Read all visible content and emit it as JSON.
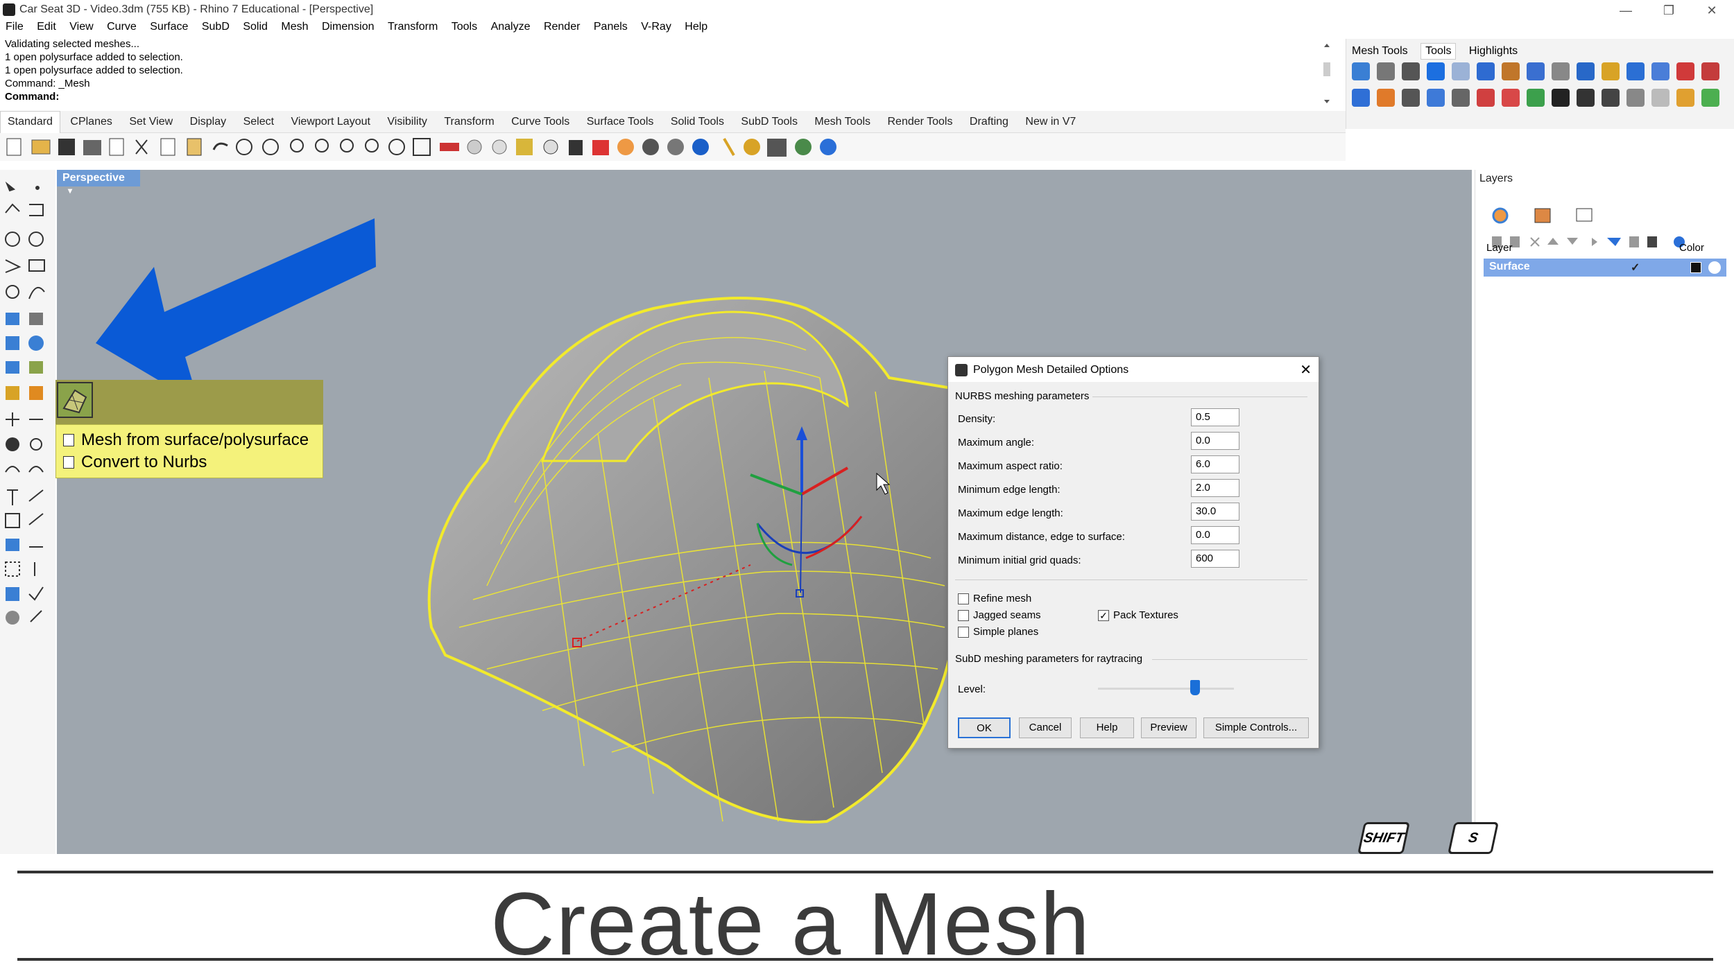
{
  "window": {
    "title": "Car Seat 3D - Video.3dm (755 KB) - Rhino 7 Educational - [Perspective]",
    "minimize": "—",
    "restore": "❐",
    "close": "✕"
  },
  "menu": [
    "File",
    "Edit",
    "View",
    "Curve",
    "Surface",
    "SubD",
    "Solid",
    "Mesh",
    "Dimension",
    "Transform",
    "Tools",
    "Analyze",
    "Render",
    "Panels",
    "V-Ray",
    "Help"
  ],
  "command_history": [
    "Validating selected meshes...",
    "1 open polysurface added to selection.",
    "1 open polysurface added to selection.",
    "Command: _Mesh"
  ],
  "command_prompt": "Command:",
  "toolbar_tabs": [
    "Standard",
    "CPlanes",
    "Set View",
    "Display",
    "Select",
    "Viewport Layout",
    "Visibility",
    "Transform",
    "Curve Tools",
    "Surface Tools",
    "Solid Tools",
    "SubD Tools",
    "Mesh Tools",
    "Render Tools",
    "Drafting",
    "New in V7"
  ],
  "right_panel_tabs": [
    "Mesh Tools",
    "Tools",
    "Highlights"
  ],
  "viewport": {
    "label": "Perspective"
  },
  "layers_panel": {
    "title": "Layers",
    "col_layer": "Layer",
    "col_color": "Color",
    "row_name": "Surface",
    "row_check": "✓"
  },
  "tooltip": {
    "items": [
      "Mesh from surface/polysurface",
      "Convert to Nurbs"
    ]
  },
  "dialog": {
    "title": "Polygon Mesh Detailed Options",
    "close": "✕",
    "nurbs_section": "NURBS meshing parameters",
    "params": [
      {
        "label": "Density:",
        "value": "0.5"
      },
      {
        "label": "Maximum angle:",
        "value": "0.0"
      },
      {
        "label": "Maximum aspect ratio:",
        "value": "6.0"
      },
      {
        "label": "Minimum edge length:",
        "value": "2.0"
      },
      {
        "label": "Maximum edge length:",
        "value": "30.0"
      },
      {
        "label": "Maximum distance, edge to surface:",
        "value": "0.0"
      },
      {
        "label": "Minimum initial grid quads:",
        "value": "600"
      }
    ],
    "checkboxes": {
      "refine_mesh": "Refine mesh",
      "jagged_seams": "Jagged seams",
      "simple_planes": "Simple planes",
      "pack_textures": "Pack Textures",
      "pack_mark": "✓"
    },
    "subd_section": "SubD meshing parameters for raytracing",
    "level_label": "Level:",
    "level_value_fraction": 0.73,
    "buttons": {
      "ok": "OK",
      "cancel": "Cancel",
      "help": "Help",
      "preview": "Preview",
      "simple": "Simple Controls..."
    }
  },
  "keys": {
    "shift": "SHIFT",
    "s": "S"
  },
  "caption": "Create a Mesh",
  "colors": {
    "viewport_bg": "#9ea6ae",
    "wire": "#f2ea2c",
    "arrow": "#0a5ad6",
    "tooltip_bg": "#f4f27b",
    "selected_row": "#7fa8e8"
  }
}
